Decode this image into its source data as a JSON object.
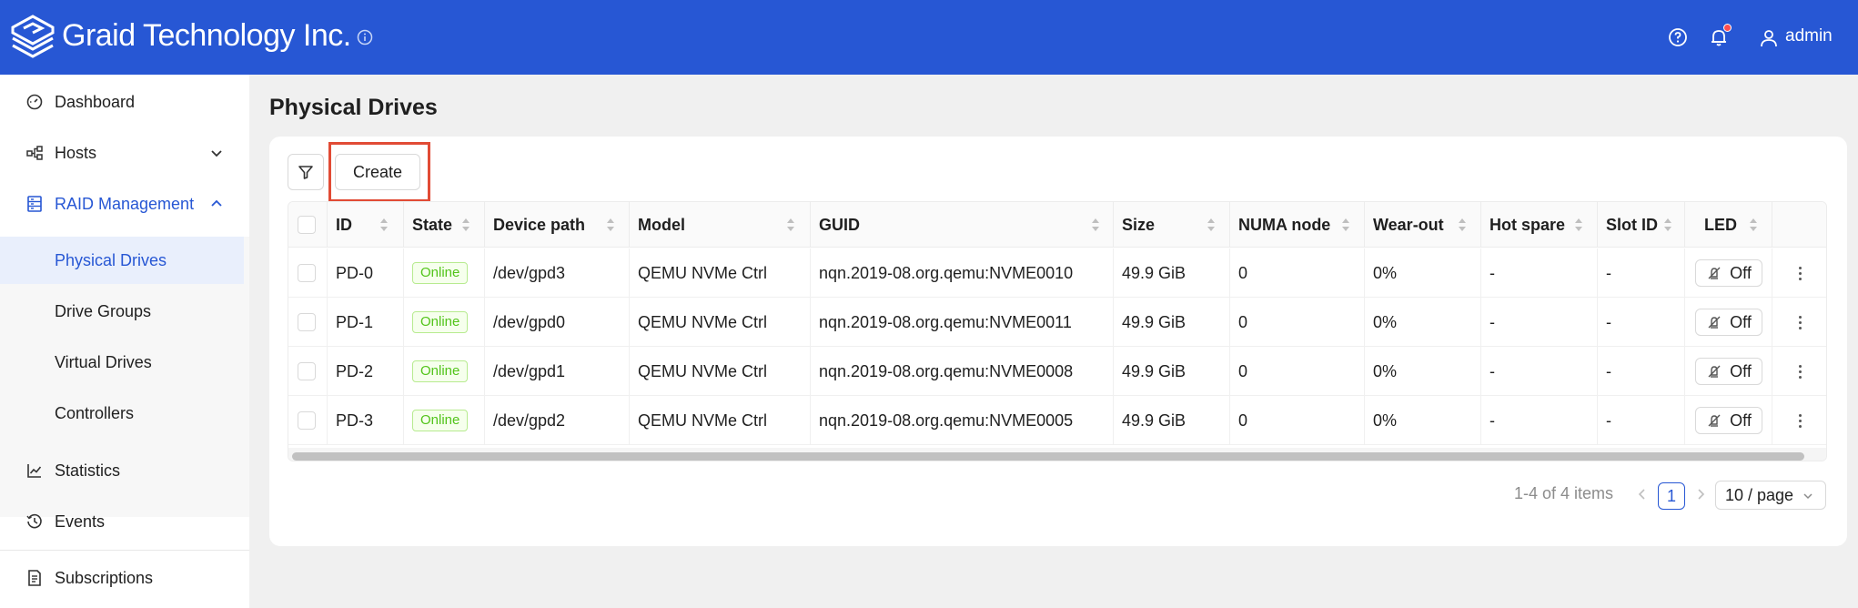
{
  "header": {
    "brand": "Graid Technology Inc.",
    "user": "admin",
    "icons": [
      "graid-logo-icon",
      "info-icon",
      "help-icon",
      "bell-icon",
      "user-icon"
    ],
    "accent_color": "#2757d4",
    "notification_dot_color": "#ff4d4f"
  },
  "sidebar": {
    "items": [
      {
        "label": "Dashboard",
        "icon": "dashboard-icon"
      },
      {
        "label": "Hosts",
        "icon": "hosts-icon"
      },
      {
        "label": "RAID Management",
        "icon": "raid-icon"
      },
      {
        "label": "Statistics",
        "icon": "statistics-icon"
      },
      {
        "label": "Events",
        "icon": "events-icon"
      },
      {
        "label": "Subscriptions",
        "icon": "subscriptions-icon"
      }
    ],
    "raid_submenu": [
      {
        "label": "Physical Drives",
        "active": true
      },
      {
        "label": "Drive Groups"
      },
      {
        "label": "Virtual Drives"
      },
      {
        "label": "Controllers"
      }
    ]
  },
  "main": {
    "title": "Physical Drives",
    "create_label": "Create",
    "columns": [
      "ID",
      "State",
      "Device path",
      "Model",
      "GUID",
      "Size",
      "NUMA node",
      "Wear-out",
      "Hot spare",
      "Slot ID",
      "LED"
    ],
    "rows": [
      {
        "id": "PD-0",
        "state": "Online",
        "device_path": "/dev/gpd3",
        "model": "QEMU NVMe Ctrl",
        "guid": "nqn.2019-08.org.qemu:NVME0010",
        "size": "49.9 GiB",
        "numa": "0",
        "wear": "0%",
        "hot_spare": "-",
        "slot": "-",
        "led": "Off"
      },
      {
        "id": "PD-1",
        "state": "Online",
        "device_path": "/dev/gpd0",
        "model": "QEMU NVMe Ctrl",
        "guid": "nqn.2019-08.org.qemu:NVME0011",
        "size": "49.9 GiB",
        "numa": "0",
        "wear": "0%",
        "hot_spare": "-",
        "slot": "-",
        "led": "Off"
      },
      {
        "id": "PD-2",
        "state": "Online",
        "device_path": "/dev/gpd1",
        "model": "QEMU NVMe Ctrl",
        "guid": "nqn.2019-08.org.qemu:NVME0008",
        "size": "49.9 GiB",
        "numa": "0",
        "wear": "0%",
        "hot_spare": "-",
        "slot": "-",
        "led": "Off"
      },
      {
        "id": "PD-3",
        "state": "Online",
        "device_path": "/dev/gpd2",
        "model": "QEMU NVMe Ctrl",
        "guid": "nqn.2019-08.org.qemu:NVME0005",
        "size": "49.9 GiB",
        "numa": "0",
        "wear": "0%",
        "hot_spare": "-",
        "slot": "-",
        "led": "Off"
      }
    ],
    "status_color": "#52c41a",
    "highlight_color": "#e14b35"
  },
  "pagination": {
    "total": "1-4 of 4 items",
    "current_page": "1",
    "page_size": "10 / page"
  }
}
